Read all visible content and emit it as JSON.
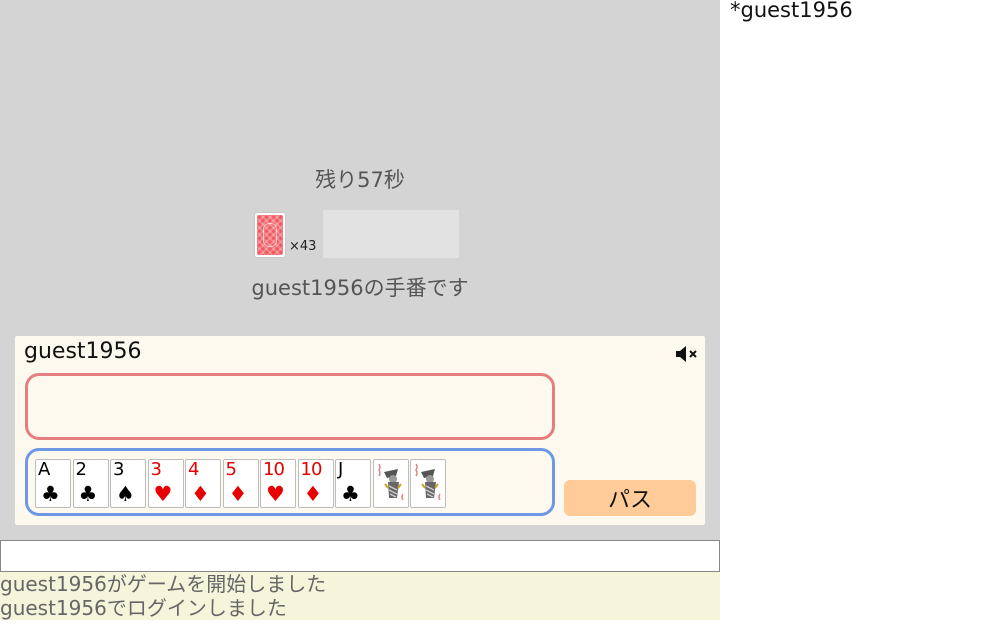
{
  "game": {
    "timer_text": "残り57秒",
    "deck_count": "×43",
    "turn_message": "guest1956の手番です"
  },
  "player": {
    "name": "guest1956",
    "mute_icon": "speaker-muted-icon",
    "pass_label": "パス"
  },
  "hand": [
    {
      "rank": "A",
      "suit": "♣",
      "color": "black"
    },
    {
      "rank": "2",
      "suit": "♣",
      "color": "black"
    },
    {
      "rank": "3",
      "suit": "♠",
      "color": "black"
    },
    {
      "rank": "3",
      "suit": "♥",
      "color": "red"
    },
    {
      "rank": "4",
      "suit": "♦",
      "color": "red"
    },
    {
      "rank": "5",
      "suit": "♦",
      "color": "red"
    },
    {
      "rank": "10",
      "suit": "♥",
      "color": "red"
    },
    {
      "rank": "10",
      "suit": "♦",
      "color": "red"
    },
    {
      "rank": "J",
      "suit": "♣",
      "color": "black"
    },
    {
      "rank": "Joker",
      "suit": "",
      "color": "joker"
    },
    {
      "rank": "Joker",
      "suit": "",
      "color": "joker"
    }
  ],
  "chat": {
    "input_value": "",
    "log": [
      "guest1956がゲームを開始しました",
      "guest1956でログインしました"
    ]
  },
  "users": [
    "*guest1956"
  ],
  "colors": {
    "game_bg": "#d4d4d4",
    "panel_bg": "#fdf9ee",
    "play_zone_border": "#e57f7f",
    "hand_zone_border": "#6e98e3",
    "pass_button": "#ffcc99",
    "log_bg": "#f5f5dc",
    "red_suit": "#e60000"
  }
}
